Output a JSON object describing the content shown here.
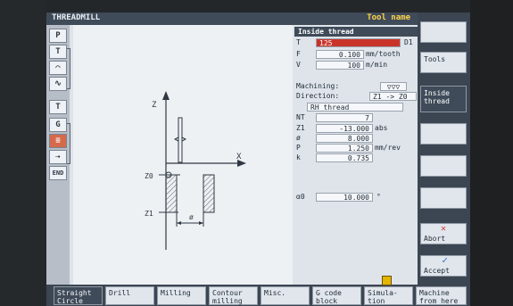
{
  "title_bar": {
    "app": "THREADMILL",
    "tool_name_label": "Tool name"
  },
  "left_strip": {
    "buttons": [
      "P",
      "T",
      "",
      "",
      "T",
      "G",
      "",
      "",
      "END"
    ]
  },
  "graphic": {
    "labels": {
      "z_axis": "Z",
      "x_axis": "X",
      "z0": "Z0",
      "z1": "Z1",
      "dia": "ø"
    }
  },
  "params": {
    "header": "Inside thread",
    "t": {
      "label": "T",
      "value": "125",
      "suffix": "D1"
    },
    "f": {
      "label": "F",
      "value": "0.100",
      "unit": "mm/tooth"
    },
    "v": {
      "label": "V",
      "value": "100",
      "unit": "m/min"
    },
    "machining": {
      "label": "Machining:",
      "value": "▽▽▽"
    },
    "direction": {
      "label": "Direction:",
      "value": "Z1 -> Z0"
    },
    "rh_thread": {
      "value": "RH thread"
    },
    "nt": {
      "label": "NT",
      "value": "7"
    },
    "z1": {
      "label": "Z1",
      "value": "-13.000",
      "unit": "abs"
    },
    "dia": {
      "label": "ø",
      "value": "8.000"
    },
    "p": {
      "label": "P",
      "value": "1.250",
      "unit": "mm/rev"
    },
    "k": {
      "label": "k",
      "value": "0.735"
    },
    "alpha0": {
      "label": "α0",
      "value": "10.000",
      "unit": "°"
    }
  },
  "vertical_softkeys": [
    {
      "label": ""
    },
    {
      "label": "Tools"
    },
    {
      "label": "Inside\nthread"
    },
    {
      "label": ""
    },
    {
      "label": ""
    },
    {
      "label": ""
    },
    {
      "label": "Abort"
    },
    {
      "label": "Accept"
    }
  ],
  "horizontal_softkeys": [
    {
      "label": "Straight\nCircle"
    },
    {
      "label": "Drill"
    },
    {
      "label": "Milling"
    },
    {
      "label": "Contour\nmilling"
    },
    {
      "label": "Misc."
    },
    {
      "label": "G code\nblock"
    },
    {
      "label": "Simula-\ntion"
    },
    {
      "label": "Machine\nfrom here"
    }
  ],
  "colors": {
    "header_bg": "#3f4b59",
    "tool_value_bg": "#c9342a",
    "accent_yellow": "#ffd34a"
  }
}
